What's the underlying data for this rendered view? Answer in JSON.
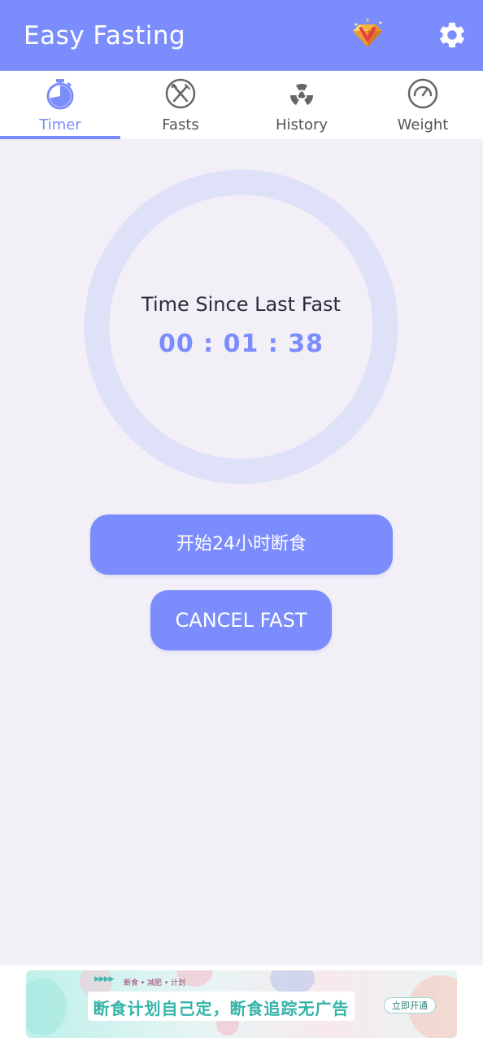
{
  "header": {
    "title": "Easy Fasting",
    "vip_icon": "vip-diamond-icon",
    "settings_icon": "gear-icon",
    "background": "#7b8cfc"
  },
  "tabs": [
    {
      "label": "Timer",
      "icon": "stopwatch-icon",
      "active": true
    },
    {
      "label": "Fasts",
      "icon": "fork-knife-icon",
      "active": false
    },
    {
      "label": "History",
      "icon": "radiation-icon",
      "active": false
    },
    {
      "label": "Weight",
      "icon": "scale-gauge-icon",
      "active": false
    }
  ],
  "timer": {
    "label": "Time Since Last Fast",
    "elapsed": "00 : 01 : 38",
    "progress": 0
  },
  "buttons": {
    "start_label": "开始24小时断食",
    "cancel_label": "CANCEL FAST"
  },
  "ad": {
    "arrows": "▶▶▶▶",
    "tag": "断食 • 减肥 • 计划",
    "headline": "断食计划自己定，断食追踪无广告",
    "cta": "立即开通"
  },
  "colors": {
    "accent": "#7b8cfc",
    "ring": "#dfe1f8",
    "background": "#f2eff7",
    "inactive_tab": "#555555"
  }
}
